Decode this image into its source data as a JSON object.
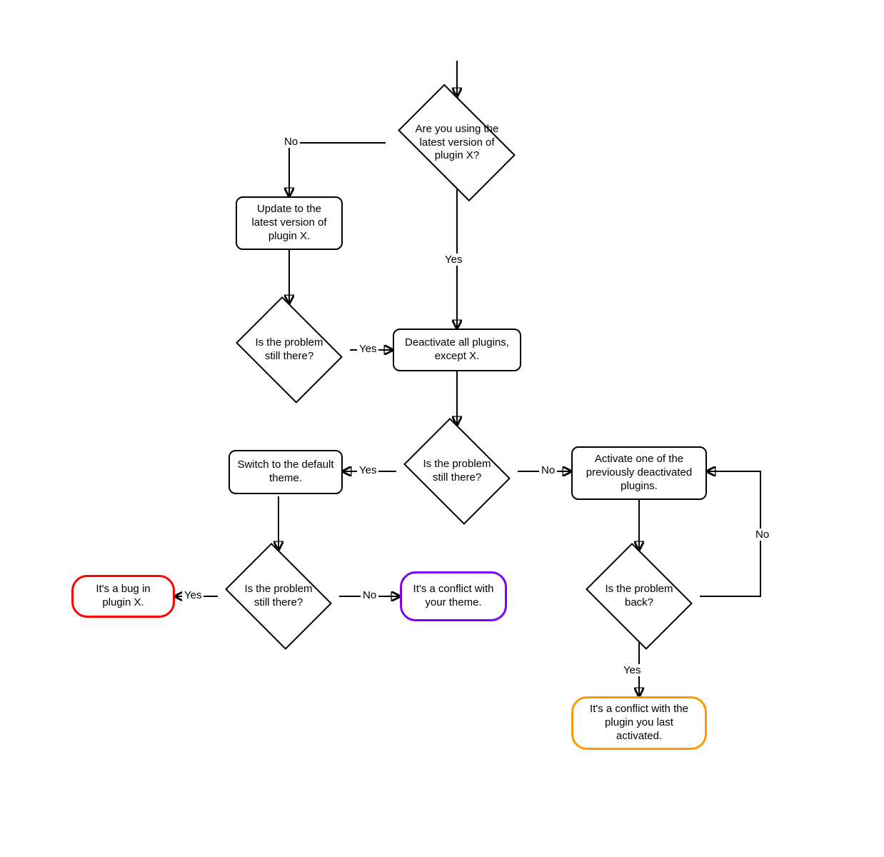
{
  "nodes": {
    "d1": "Are you using the latest version of plugin X?",
    "p_update": "Update to the latest version of plugin X.",
    "d2": "Is the problem still there?",
    "p_deactivate": "Deactivate all plugins, except X.",
    "d3": "Is the problem still there?",
    "p_switch_theme": "Switch to the default theme.",
    "p_activate_one": "Activate one of the previously deactivated plugins.",
    "d4": "Is the problem still there?",
    "d5": "Is the problem back?",
    "t_bug": "It's a bug in plugin X.",
    "t_theme": "It's a conflict with your theme.",
    "t_plugin": "It's a conflict with the plugin you last activated."
  },
  "edge_labels": {
    "yes": "Yes",
    "no": "No"
  },
  "colors": {
    "bug": "#ff0000",
    "theme": "#7a00ff",
    "plugin": "#ff9900"
  }
}
